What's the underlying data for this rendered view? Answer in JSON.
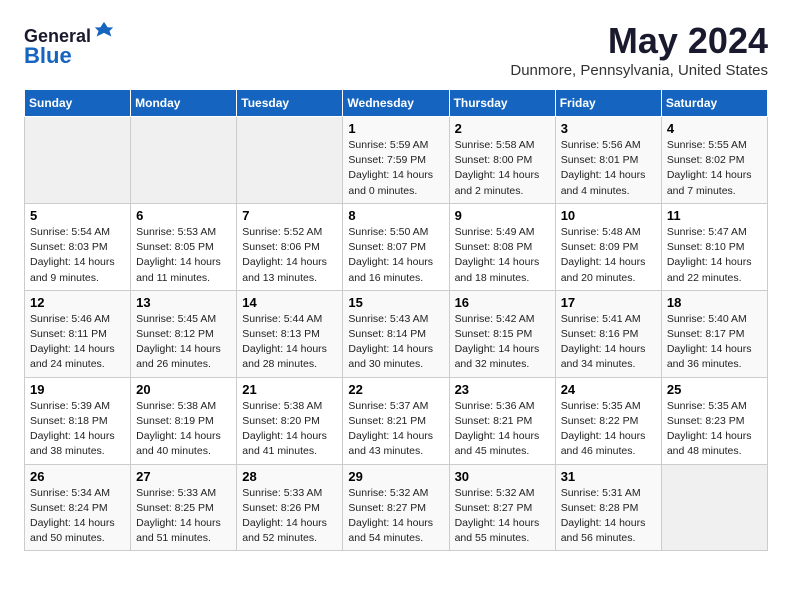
{
  "header": {
    "logo_general": "General",
    "logo_blue": "Blue",
    "month_year": "May 2024",
    "location": "Dunmore, Pennsylvania, United States"
  },
  "weekdays": [
    "Sunday",
    "Monday",
    "Tuesday",
    "Wednesday",
    "Thursday",
    "Friday",
    "Saturday"
  ],
  "weeks": [
    [
      {
        "day": "",
        "info": ""
      },
      {
        "day": "",
        "info": ""
      },
      {
        "day": "",
        "info": ""
      },
      {
        "day": "1",
        "info": "Sunrise: 5:59 AM\nSunset: 7:59 PM\nDaylight: 14 hours\nand 0 minutes."
      },
      {
        "day": "2",
        "info": "Sunrise: 5:58 AM\nSunset: 8:00 PM\nDaylight: 14 hours\nand 2 minutes."
      },
      {
        "day": "3",
        "info": "Sunrise: 5:56 AM\nSunset: 8:01 PM\nDaylight: 14 hours\nand 4 minutes."
      },
      {
        "day": "4",
        "info": "Sunrise: 5:55 AM\nSunset: 8:02 PM\nDaylight: 14 hours\nand 7 minutes."
      }
    ],
    [
      {
        "day": "5",
        "info": "Sunrise: 5:54 AM\nSunset: 8:03 PM\nDaylight: 14 hours\nand 9 minutes."
      },
      {
        "day": "6",
        "info": "Sunrise: 5:53 AM\nSunset: 8:05 PM\nDaylight: 14 hours\nand 11 minutes."
      },
      {
        "day": "7",
        "info": "Sunrise: 5:52 AM\nSunset: 8:06 PM\nDaylight: 14 hours\nand 13 minutes."
      },
      {
        "day": "8",
        "info": "Sunrise: 5:50 AM\nSunset: 8:07 PM\nDaylight: 14 hours\nand 16 minutes."
      },
      {
        "day": "9",
        "info": "Sunrise: 5:49 AM\nSunset: 8:08 PM\nDaylight: 14 hours\nand 18 minutes."
      },
      {
        "day": "10",
        "info": "Sunrise: 5:48 AM\nSunset: 8:09 PM\nDaylight: 14 hours\nand 20 minutes."
      },
      {
        "day": "11",
        "info": "Sunrise: 5:47 AM\nSunset: 8:10 PM\nDaylight: 14 hours\nand 22 minutes."
      }
    ],
    [
      {
        "day": "12",
        "info": "Sunrise: 5:46 AM\nSunset: 8:11 PM\nDaylight: 14 hours\nand 24 minutes."
      },
      {
        "day": "13",
        "info": "Sunrise: 5:45 AM\nSunset: 8:12 PM\nDaylight: 14 hours\nand 26 minutes."
      },
      {
        "day": "14",
        "info": "Sunrise: 5:44 AM\nSunset: 8:13 PM\nDaylight: 14 hours\nand 28 minutes."
      },
      {
        "day": "15",
        "info": "Sunrise: 5:43 AM\nSunset: 8:14 PM\nDaylight: 14 hours\nand 30 minutes."
      },
      {
        "day": "16",
        "info": "Sunrise: 5:42 AM\nSunset: 8:15 PM\nDaylight: 14 hours\nand 32 minutes."
      },
      {
        "day": "17",
        "info": "Sunrise: 5:41 AM\nSunset: 8:16 PM\nDaylight: 14 hours\nand 34 minutes."
      },
      {
        "day": "18",
        "info": "Sunrise: 5:40 AM\nSunset: 8:17 PM\nDaylight: 14 hours\nand 36 minutes."
      }
    ],
    [
      {
        "day": "19",
        "info": "Sunrise: 5:39 AM\nSunset: 8:18 PM\nDaylight: 14 hours\nand 38 minutes."
      },
      {
        "day": "20",
        "info": "Sunrise: 5:38 AM\nSunset: 8:19 PM\nDaylight: 14 hours\nand 40 minutes."
      },
      {
        "day": "21",
        "info": "Sunrise: 5:38 AM\nSunset: 8:20 PM\nDaylight: 14 hours\nand 41 minutes."
      },
      {
        "day": "22",
        "info": "Sunrise: 5:37 AM\nSunset: 8:21 PM\nDaylight: 14 hours\nand 43 minutes."
      },
      {
        "day": "23",
        "info": "Sunrise: 5:36 AM\nSunset: 8:21 PM\nDaylight: 14 hours\nand 45 minutes."
      },
      {
        "day": "24",
        "info": "Sunrise: 5:35 AM\nSunset: 8:22 PM\nDaylight: 14 hours\nand 46 minutes."
      },
      {
        "day": "25",
        "info": "Sunrise: 5:35 AM\nSunset: 8:23 PM\nDaylight: 14 hours\nand 48 minutes."
      }
    ],
    [
      {
        "day": "26",
        "info": "Sunrise: 5:34 AM\nSunset: 8:24 PM\nDaylight: 14 hours\nand 50 minutes."
      },
      {
        "day": "27",
        "info": "Sunrise: 5:33 AM\nSunset: 8:25 PM\nDaylight: 14 hours\nand 51 minutes."
      },
      {
        "day": "28",
        "info": "Sunrise: 5:33 AM\nSunset: 8:26 PM\nDaylight: 14 hours\nand 52 minutes."
      },
      {
        "day": "29",
        "info": "Sunrise: 5:32 AM\nSunset: 8:27 PM\nDaylight: 14 hours\nand 54 minutes."
      },
      {
        "day": "30",
        "info": "Sunrise: 5:32 AM\nSunset: 8:27 PM\nDaylight: 14 hours\nand 55 minutes."
      },
      {
        "day": "31",
        "info": "Sunrise: 5:31 AM\nSunset: 8:28 PM\nDaylight: 14 hours\nand 56 minutes."
      },
      {
        "day": "",
        "info": ""
      }
    ]
  ]
}
